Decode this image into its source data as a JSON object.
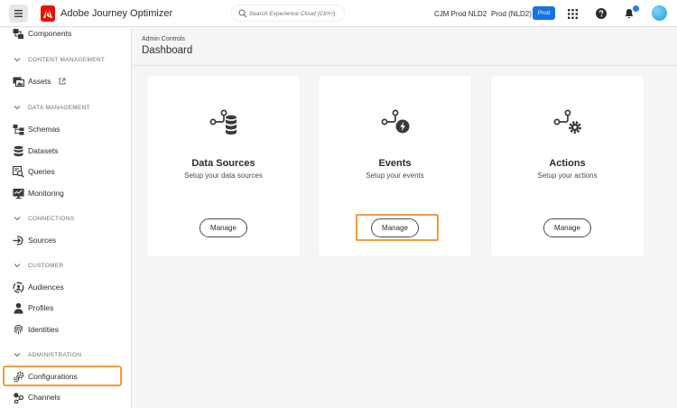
{
  "app": {
    "title": "Adobe Journey Optimizer"
  },
  "search": {
    "placeholder": "Search Experience Cloud (Ctrl+/)"
  },
  "org": {
    "name": "CJM Prod NLD2",
    "sandbox": "Prod (NLD2)",
    "env_badge": "Prod"
  },
  "topbar_icons": [
    "apps-grid-icon",
    "help-icon",
    "bell-icon",
    "avatar"
  ],
  "colors": {
    "accent": "#1473e6",
    "highlight": "#f39c3b",
    "adobe_red": "#eb1000"
  },
  "sidebar": {
    "components": "Components",
    "content_management": "CONTENT MANAGEMENT",
    "assets": "Assets",
    "data_management": "DATA MANAGEMENT",
    "schemas": "Schemas",
    "datasets": "Datasets",
    "queries": "Queries",
    "monitoring": "Monitoring",
    "connections": "CONNECTIONS",
    "sources": "Sources",
    "customer": "CUSTOMER",
    "audiences": "Audiences",
    "profiles": "Profiles",
    "identities": "Identities",
    "administration": "ADMINISTRATION",
    "configurations": "Configurations",
    "channels": "Channels",
    "selected": "Configurations"
  },
  "main": {
    "breadcrumb": "Admin Controls",
    "title": "Dashboard",
    "cards": [
      {
        "icon": "data-sources-icon",
        "title": "Data Sources",
        "subtitle": "Setup your data sources",
        "button": "Manage"
      },
      {
        "icon": "events-icon",
        "title": "Events",
        "subtitle": "Setup your events",
        "button": "Manage"
      },
      {
        "icon": "actions-icon",
        "title": "Actions",
        "subtitle": "Setup your actions",
        "button": "Manage"
      }
    ]
  }
}
